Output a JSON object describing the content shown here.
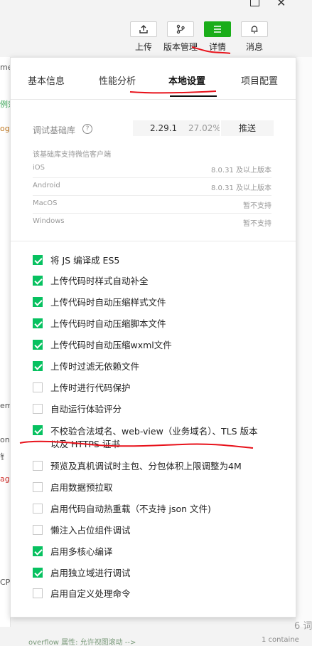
{
  "toolbar": {
    "items": [
      {
        "label": "上传",
        "icon": "upload-icon"
      },
      {
        "label": "版本管理",
        "icon": "branch-icon"
      },
      {
        "label": "详情",
        "icon": "menu-icon",
        "active": true
      },
      {
        "label": "消息",
        "icon": "bell-icon"
      }
    ]
  },
  "tabs": [
    {
      "label": "基本信息"
    },
    {
      "label": "性能分析"
    },
    {
      "label": "本地设置",
      "active": true
    },
    {
      "label": "项目配置"
    }
  ],
  "base_lib": {
    "label": "调试基础库",
    "version": "2.29.1",
    "percent": "27.02%",
    "push_label": "推送"
  },
  "support_note": "该基础库支持微信客户端",
  "platforms": [
    {
      "name": "iOS",
      "value": "8.0.31 及以上版本"
    },
    {
      "name": "Android",
      "value": "8.0.31 及以上版本"
    },
    {
      "name": "MacOS",
      "value": "暂不支持"
    },
    {
      "name": "Windows",
      "value": "暂不支持"
    }
  ],
  "options": [
    {
      "label": "将 JS 编译成 ES5",
      "checked": true
    },
    {
      "label": "上传代码时样式自动补全",
      "checked": true
    },
    {
      "label": "上传代码时自动压缩样式文件",
      "checked": true
    },
    {
      "label": "上传代码时自动压缩脚本文件",
      "checked": true
    },
    {
      "label": "上传代码时自动压缩wxml文件",
      "checked": true
    },
    {
      "label": "上传时过滤无依赖文件",
      "checked": true
    },
    {
      "label": "上传时进行代码保护",
      "checked": false
    },
    {
      "label": "自动运行体验评分",
      "checked": false
    },
    {
      "label": "不校验合法域名、web-view（业务域名）、TLS 版本以及 HTTPS 证书",
      "checked": true
    },
    {
      "label": "预览及真机调试时主包、分包体积上限调整为4M",
      "checked": false
    },
    {
      "label": "启用数据预拉取",
      "checked": false
    },
    {
      "label": "启用代码自动热重载（不支持 json 文件)",
      "checked": false
    },
    {
      "label": "懒注入占位组件调试",
      "checked": false
    },
    {
      "label": "启用多核心编译",
      "checked": true
    },
    {
      "label": "启用独立域进行调试",
      "checked": true
    },
    {
      "label": "启用自定义处理命令",
      "checked": false
    }
  ],
  "edge_fragments": {
    "left": [
      "me",
      "例郊",
      "og",
      "em",
      "one",
      "钅",
      "ag",
      "CP"
    ],
    "right_bottom": "6 词",
    "bottom_code": "overflow 属性: 允许视图滚动 -->",
    "bottom_right_code": "1   containe"
  },
  "colors": {
    "accent_green": "#07c160",
    "toolbar_active": "#1aad19",
    "annotation_red": "#e8121b"
  }
}
